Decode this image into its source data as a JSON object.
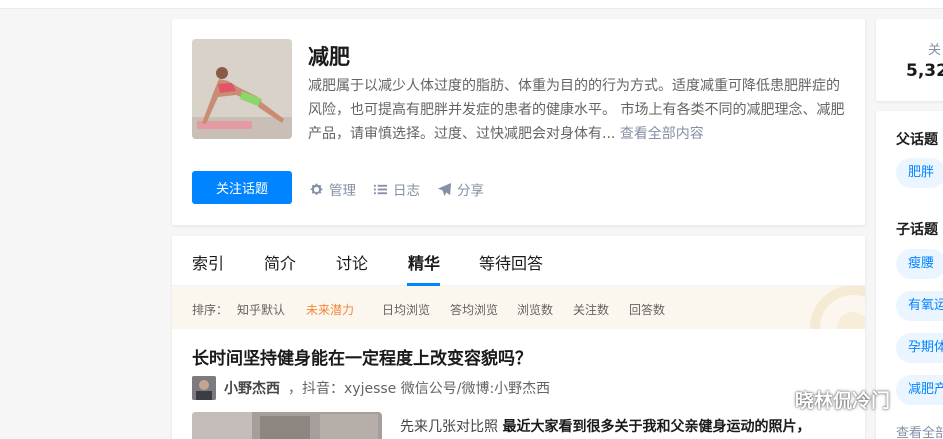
{
  "topic": {
    "title": "减肥",
    "description": "减肥属于以减少人体过度的脂肪、体重为目的的行为方式。适度减重可降低患肥胖症的风险，也可提高有肥胖并发症的患者的健康水平。 市场上有各类不同的减肥理念、减肥产品，请审慎选择。过度、过快减肥会对身体有...",
    "view_all": "查看全部内容",
    "follow_button": "关注话题",
    "actions": [
      {
        "label": "管理",
        "icon": "gear-icon"
      },
      {
        "label": "日志",
        "icon": "list-icon"
      },
      {
        "label": "分享",
        "icon": "paper-plane-icon"
      }
    ]
  },
  "tabs": [
    "索引",
    "简介",
    "讨论",
    "精华",
    "等待回答"
  ],
  "active_tab": "精华",
  "sortbar": {
    "label": "排序：",
    "options": [
      "知乎默认",
      "未来潜力",
      "日均浏览",
      "答均浏览",
      "浏览数",
      "关注数",
      "回答数"
    ],
    "active": "未来潜力"
  },
  "feed": {
    "question": "长时间坚持健身能在一定程度上改变容貌吗？",
    "author_name": "小野杰西",
    "author_bio": "，抖音：xyjesse 微信公号/微博:小野杰西",
    "excerpt_prefix": "先来几张对比照 ",
    "excerpt_bold": "最近大家看到很多关于我和父亲健身运动的照片，"
  },
  "sidebar": {
    "stat_label": "关",
    "stat_value": "5,32",
    "parent_heading": "父话题",
    "parent_topics": [
      "肥胖"
    ],
    "child_heading": "子话题",
    "child_topics": [
      "瘦腰",
      "有氧运",
      "孕期体",
      "减肥产"
    ],
    "view_all": "查看全部"
  },
  "watermark": "晓林侃冷门",
  "colors": {
    "primary": "#0084ff",
    "active_sort": "#f1883c",
    "muted": "#8590a6",
    "sortbar_bg": "#fcf7ee",
    "chip_bg": "#ebf5ff"
  }
}
